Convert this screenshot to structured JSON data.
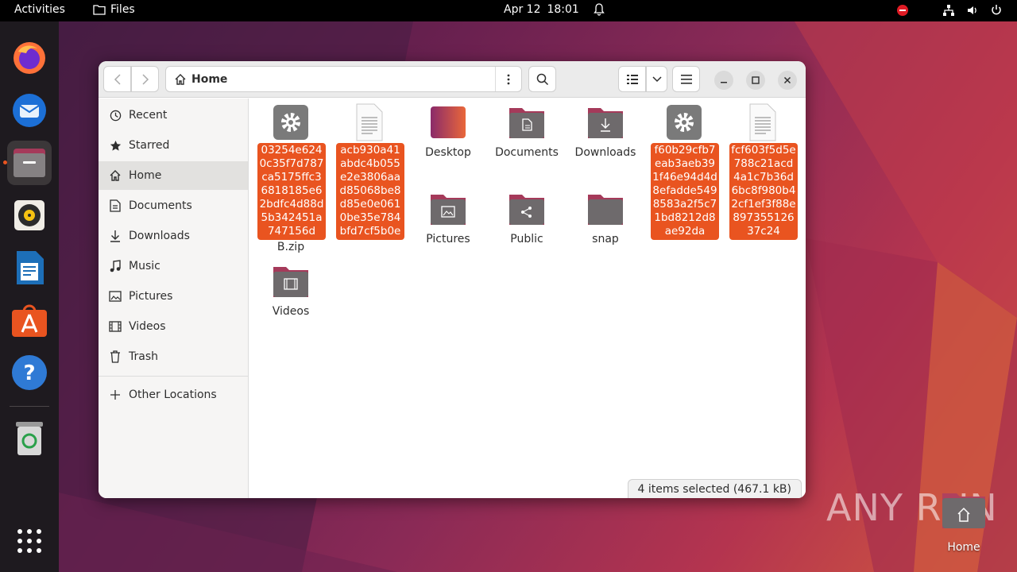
{
  "topbar": {
    "activities": "Activities",
    "app_name": "Files",
    "date": "Apr 12",
    "time": "18:01"
  },
  "dock": {
    "items": [
      "firefox",
      "thunderbird",
      "files",
      "rhythmbox",
      "libreoffice-writer",
      "app-center",
      "help",
      "trash",
      "show-apps"
    ]
  },
  "window": {
    "path_label": "Home",
    "sidebar": [
      {
        "label": "Recent",
        "icon": "clock-icon"
      },
      {
        "label": "Starred",
        "icon": "star-icon"
      },
      {
        "label": "Home",
        "icon": "home-icon",
        "active": true
      },
      {
        "label": "Documents",
        "icon": "document-icon"
      },
      {
        "label": "Downloads",
        "icon": "download-icon"
      },
      {
        "label": "Music",
        "icon": "music-icon"
      },
      {
        "label": "Pictures",
        "icon": "picture-icon"
      },
      {
        "label": "Videos",
        "icon": "video-icon"
      },
      {
        "label": "Trash",
        "icon": "trash-icon"
      },
      {
        "label": "Other Locations",
        "icon": "plus-icon"
      }
    ],
    "files": [
      {
        "name": "03254e6240c35f7d787ca5175ffc36818185e62bdfc4d88d5b342451a747156d",
        "under": "B.zip",
        "type": "executable",
        "selected": true
      },
      {
        "name": "acb930a41abdc4b055e2e3806aad85068be8d85e0e0610be35e784bfd7cf5b0e",
        "under": "",
        "type": "text",
        "selected": true
      },
      {
        "name": "Desktop",
        "type": "folder-desktop"
      },
      {
        "name": "Documents",
        "type": "folder-documents"
      },
      {
        "name": "Downloads",
        "type": "folder-downloads"
      },
      {
        "name": "f60b29cfb7eab3aeb391f46e94d4d8efadde5498583a2f5c71bd8212d8ae92da",
        "under": "",
        "type": "executable",
        "selected": true
      },
      {
        "name": "fcf603f5d5e788c21acd4a1c7b36d6bc8f980b42cf1ef3f88e89735512637c24",
        "under": "",
        "type": "text",
        "selected": true
      },
      {
        "name": "Pictures",
        "type": "folder-pictures"
      },
      {
        "name": "Public",
        "type": "folder-public"
      },
      {
        "name": "snap",
        "type": "folder"
      },
      {
        "name": "Videos",
        "type": "folder-videos"
      }
    ],
    "status": "4 items selected  (467.1 kB)"
  },
  "desktop": {
    "watermark": "ANY RUN",
    "home_label": "Home"
  },
  "colors": {
    "accent": "#e95420",
    "folder_top": "#a53a5a",
    "folder_body": "#6e6a6c"
  }
}
